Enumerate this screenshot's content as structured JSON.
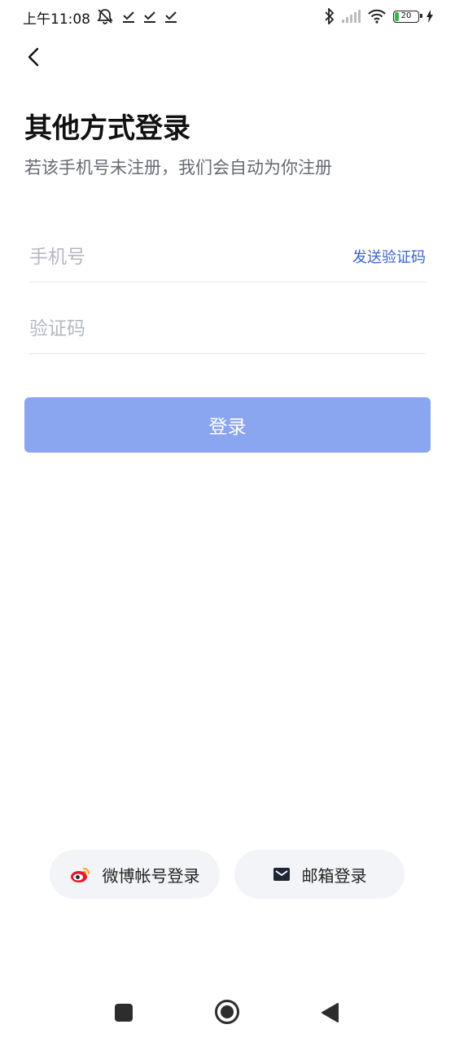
{
  "status_bar": {
    "time": "上午11:08",
    "battery_level": "20",
    "icons": [
      "alarm-off-icon",
      "download-done-icon",
      "download-done-icon",
      "download-done-icon",
      "bluetooth-icon",
      "signal-icon",
      "wifi-icon",
      "battery-icon",
      "charging-icon"
    ]
  },
  "header": {
    "back_icon": "chevron-left-icon",
    "title": "其他方式登录",
    "subtitle": "若该手机号未注册，我们会自动为你注册"
  },
  "form": {
    "phone_placeholder": "手机号",
    "phone_value": "",
    "send_code_label": "发送验证码",
    "code_placeholder": "验证码",
    "code_value": "",
    "login_label": "登录"
  },
  "alt_logins": {
    "weibo_label": "微博帐号登录",
    "weibo_icon": "weibo-icon",
    "email_label": "邮箱登录",
    "email_icon": "mail-icon"
  },
  "nav_bar": {
    "icons": [
      "recent-apps-icon",
      "home-icon",
      "back-icon"
    ]
  },
  "colors": {
    "primary_disabled": "#8aa6f0",
    "link": "#3a63c9",
    "pill_bg": "#f2f4f7",
    "subtitle": "#666b73"
  }
}
